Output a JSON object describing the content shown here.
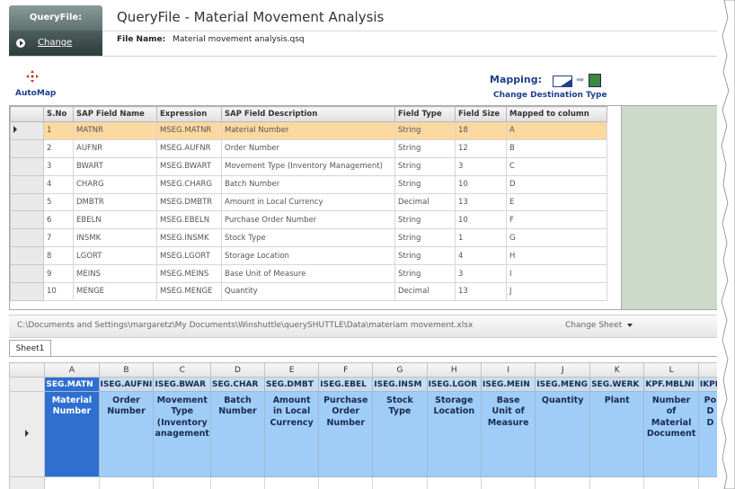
{
  "header": {
    "tab_label": "QueryFile:",
    "change_label": "Change",
    "title": "QueryFile - Material Movement Analysis",
    "file_name_label": "File Name:",
    "file_name_value": "Material movement analysis.qsq"
  },
  "toolbar": {
    "automap_label": "AutoMap",
    "mapping_label": "Mapping:",
    "change_destination_label": "Change Destination Type"
  },
  "mapping_grid": {
    "columns": [
      "S.No",
      "SAP Field Name",
      "Expression",
      "SAP Field Description",
      "Field Type",
      "Field Size",
      "Mapped to column"
    ],
    "rows": [
      [
        "1",
        "MATNR",
        "MSEG.MATNR",
        "Material Number",
        "String",
        "18",
        "A"
      ],
      [
        "2",
        "AUFNR",
        "MSEG.AUFNR",
        "Order Number",
        "String",
        "12",
        "B"
      ],
      [
        "3",
        "BWART",
        "MSEG.BWART",
        "Movement Type (Inventory Management)",
        "String",
        "3",
        "C"
      ],
      [
        "4",
        "CHARG",
        "MSEG.CHARG",
        "Batch Number",
        "String",
        "10",
        "D"
      ],
      [
        "5",
        "DMBTR",
        "MSEG.DMBTR",
        "Amount in Local Currency",
        "Decimal",
        "13",
        "E"
      ],
      [
        "6",
        "EBELN",
        "MSEG.EBELN",
        "Purchase Order Number",
        "String",
        "10",
        "F"
      ],
      [
        "7",
        "INSMK",
        "MSEG.INSMK",
        "Stock Type",
        "String",
        "1",
        "G"
      ],
      [
        "8",
        "LGORT",
        "MSEG.LGORT",
        "Storage Location",
        "String",
        "4",
        "H"
      ],
      [
        "9",
        "MEINS",
        "MSEG.MEINS",
        "Base Unit of Measure",
        "String",
        "3",
        "I"
      ],
      [
        "10",
        "MENGE",
        "MSEG.MENGE",
        "Quantity",
        "Decimal",
        "13",
        "J"
      ]
    ]
  },
  "file_path": "C:\\Documents and Settings\\margaretz\\My Documents\\Winshuttle\\querySHUTTLE\\Data\\materiam movement.xlsx",
  "change_sheet_label": "Change Sheet",
  "sheet_tab": "Sheet1",
  "excel": {
    "col_letters": [
      "A",
      "B",
      "C",
      "D",
      "E",
      "F",
      "G",
      "H",
      "I",
      "J",
      "K",
      "L"
    ],
    "field_row": [
      "SEG.MATN",
      "ISEG.AUFNI",
      "ISEG.BWAR",
      "SEG.CHAR",
      "SEG.DMBT",
      "ISEG.EBEL",
      "ISEG.INSM",
      "ISEG.LGOR",
      "ISEG.MEIN",
      "ISEG.MENG",
      "SEG.WERK",
      "KPF.MBLNI",
      "IKPF"
    ],
    "desc_row": [
      "Material\nNumber",
      "Order\nNumber",
      "Movement\nType\n(Inventory\nanagement",
      "Batch\nNumber",
      "Amount\nin Local\nCurrency",
      "Purchase\nOrder\nNumber",
      "Stock\nType",
      "Storage\nLocation",
      "Base\nUnit of\nMeasure",
      "Quantity",
      "Plant",
      "Number\nof\nMaterial\nDocument",
      "Po\nD\nD"
    ]
  }
}
